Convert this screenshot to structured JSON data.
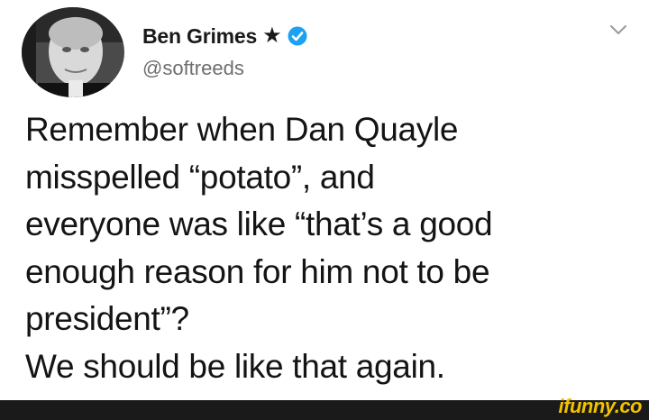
{
  "user": {
    "display_name": "Ben Grimes",
    "star": "★",
    "handle": "@softreeds",
    "verified_color": "#1da1f2"
  },
  "tweet": {
    "paragraph_1": "Remember when Dan Quayle\nmisspelled “potato”, and\neveryone was like “that’s a good\nenough reason for him not to be\npresident”?",
    "paragraph_2": "We should be like that again."
  },
  "watermark": {
    "text": "ifunny.co",
    "color": "#f2c200"
  },
  "icons": {
    "avatar": "avatar-photo",
    "star": "star-icon",
    "verified": "verified-badge-icon",
    "menu": "chevron-down-icon"
  }
}
